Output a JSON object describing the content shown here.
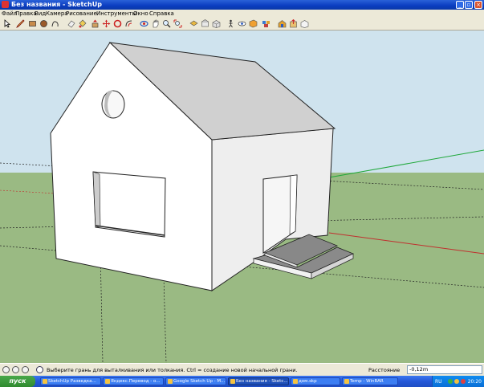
{
  "window": {
    "title": "Без названия - SketchUp",
    "buttons": [
      "_",
      "▫",
      "×"
    ]
  },
  "menubar": {
    "items": [
      "Файл",
      "Правка",
      "Вид",
      "Камера",
      "Рисование",
      "Инструменты",
      "Окно",
      "Справка"
    ]
  },
  "toolbar": {
    "tools": [
      "select-icon",
      "pencil-icon",
      "rectangle-icon",
      "circle-icon",
      "polygon-icon",
      "eraser-icon",
      "paint-bucket-icon",
      "push-pull-icon",
      "move-icon",
      "rotate-icon",
      "offset-icon",
      "orbit-icon",
      "pan-icon",
      "zoom-icon",
      "zoom-extents-icon",
      "top-view-icon",
      "front-view-icon",
      "iso-view-icon",
      "walk-icon",
      "look-icon",
      "section-icon",
      "component-icon",
      "warehouse-icon",
      "share-icon"
    ]
  },
  "colors": {
    "sky": "#cfe3ee",
    "ground": "#9aba83",
    "wall_front": "#ffffff",
    "wall_side": "#eeeeee",
    "roof": "#d0d0d0",
    "edge": "#222222",
    "axis_red": "#c0302f",
    "axis_green": "#1fa83a",
    "title_blue": "#0a3cc0"
  },
  "status": {
    "hint": "Выберите грань для выталкивания или толкания.  Ctrl = создание новой начальной грани.",
    "measure_label": "Расстояние",
    "measure_value": "-0,12m"
  },
  "taskbar": {
    "start": "пуск",
    "tasks": [
      {
        "label": "SketchUp Разведка...",
        "active": false
      },
      {
        "label": "Яндекс.Перевод - о...",
        "active": false
      },
      {
        "label": "Google Sketch Up - M...",
        "active": false
      },
      {
        "label": "Без названия - Sketc...",
        "active": true
      },
      {
        "label": "дом.skp",
        "active": false
      },
      {
        "label": "Temp - WinRAR",
        "active": false
      }
    ],
    "tray": {
      "lang": "RU",
      "clock": "20:20"
    }
  }
}
